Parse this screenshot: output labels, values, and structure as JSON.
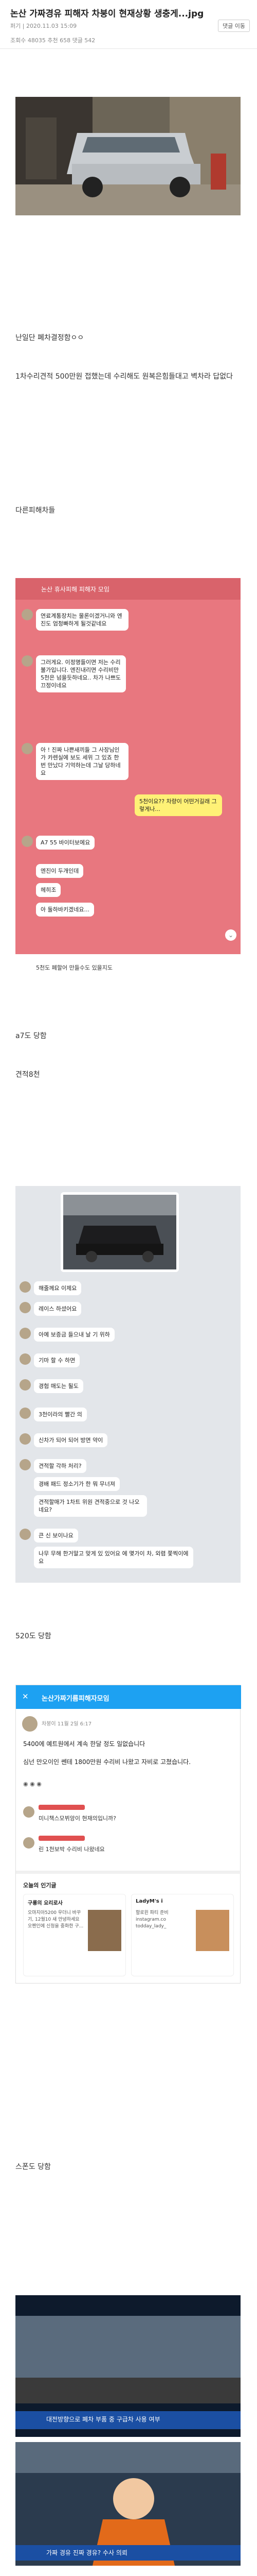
{
  "post": {
    "title": "논산 가짜경유 피해자 차붕이 현재상황 생충게...jpg",
    "meta": "퍼기 | 2020.11.03 15:09",
    "views_line": "조회수 48035   추천 658   댓글 542",
    "copy_button": "댓글 이동",
    "paragraphs": {
      "p1": "난일단 폐차결정함ㅇㅇ",
      "p2": "1차수리견적 500만원 접했는데 수리해도 원복은힘들대고 벽차라 답없다",
      "p3": "다른피해차들",
      "p4": "a7도 당함",
      "p5": "견적8천",
      "p6": "520도 당함",
      "p7": "스폰도 당함"
    }
  },
  "chat1": {
    "header": "논산 휴사피해 피해자 모임",
    "messages": [
      "연료계통장치는 물론이겠거니와 엔진도 엄청빠하게 될것같네요",
      "그러게요. 이정명들이면 저는 수리불가입니다. 엔진내리면 수리비만 5천은 넘을듯하네요.. 차가 나쁘도 끄정이네요",
      "아 ! 진짜 나쁜새끼들 그 사장님인가 카렌실에 보도 세위 그 있죠 한번 만났다 기억하는데 그날 당하네요",
      "5천이요?? 차량이 어떤거길래 그렇게나...",
      "A7 55 바이터보에요",
      "엔진이 두개인데",
      "헤히조",
      "아 둘하바키겠네요..."
    ],
    "input_text": "5천도 폐할어 만들수도 있을지도"
  },
  "chat2": {
    "messages": [
      "해줄께요 이제요",
      "레이스 하셨어요",
      "아예 보증금 들으내 날 기 위하",
      "기마 할 수 하면",
      "경험 매도는 될도",
      "3천이라의 빨간 의",
      "신차가 되어 되어 방면 약이",
      "견적할 각하 처리?",
      "경배 패드 정소기가 한 뭐 무너져",
      "견적할매가 1차트 위원 견적중으로 것 나오네요?",
      "큰 신 보이나요",
      "나무 무해 한거말고 맞게 있 있어요 에 몇가이 차, 외렴 쫓찍이에요"
    ]
  },
  "chat3": {
    "header": "논산가짜기름피해자모임",
    "post_author": "차붕이 11월 2일 6:17",
    "post_text1": "5400에 예트원에서 계속 한달 정도 일없습니다",
    "post_text2": "심넌 만오이인 쎈테 1800만원 수리비 나왔고 자비로 고쳤습니다.",
    "comment1": "미니책스모뷔앙이 현재의입니까?",
    "comment2": "린 1천보박 수리비 나왔네요",
    "section": "오늘의 인기글",
    "card1_title": "구룡의 요리로사",
    "card1_text": "오마지아5200 우더니 바꾸기, 12월10 새 안녕하세요 오펜인에 신청을 중화한 구...",
    "card2_title": "LadyM's i",
    "card2_text": "할로윈 파티 준비 instagram.co todday_lady_"
  },
  "video": {
    "caption1": "대전방향으로 폐차 부품 중 구급차 사용 여부",
    "caption2": "가짜 경유 진짜 경유? 수사 의뢰"
  },
  "colors": {
    "chat_bg": "#e8777f",
    "chat2_bg": "#e3e6ea",
    "yellow": "#fff176"
  }
}
